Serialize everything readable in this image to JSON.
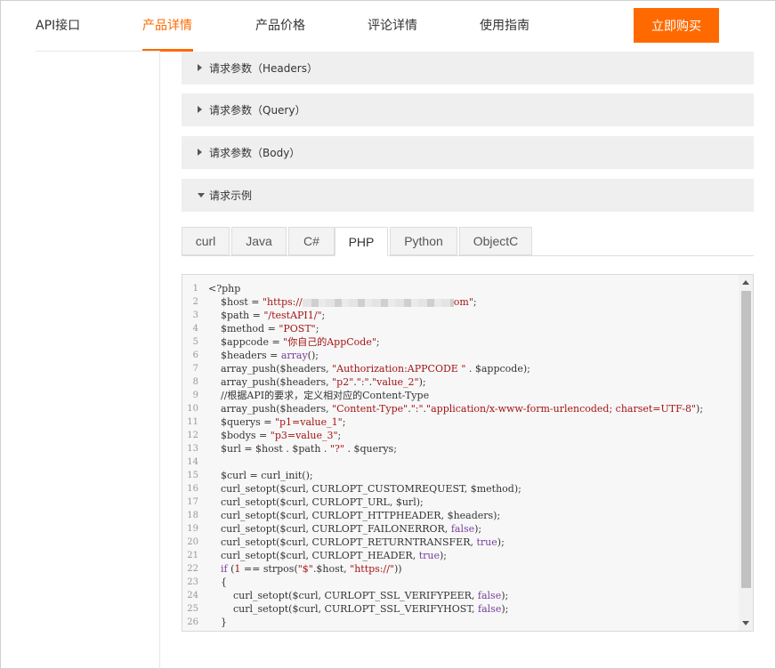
{
  "nav": {
    "items": [
      {
        "label": "API接口"
      },
      {
        "label": "产品详情"
      },
      {
        "label": "产品价格"
      },
      {
        "label": "评论详情"
      },
      {
        "label": "使用指南"
      }
    ],
    "active_index": 1,
    "buy_label": "立即购买",
    "accent_color": "#ff6a00"
  },
  "sections": [
    {
      "label": "请求参数（Headers）",
      "expanded": false
    },
    {
      "label": "请求参数（Query）",
      "expanded": false
    },
    {
      "label": "请求参数（Body）",
      "expanded": false
    },
    {
      "label": "请求示例",
      "expanded": true
    }
  ],
  "tabs": [
    {
      "label": "curl"
    },
    {
      "label": "Java"
    },
    {
      "label": "C#"
    },
    {
      "label": "PHP"
    },
    {
      "label": "Python"
    },
    {
      "label": "ObjectC"
    }
  ],
  "active_tab": "PHP",
  "code": {
    "line_numbers": [
      "1",
      "2",
      "3",
      "4",
      "5",
      "6",
      "7",
      "8",
      "9",
      "10",
      "11",
      "12",
      "13",
      "14",
      "15",
      "16",
      "17",
      "18",
      "19",
      "20",
      "21",
      "22",
      "23",
      "24",
      "25",
      "26"
    ],
    "l1": "<?php",
    "l2a": "    $host = ",
    "l2b": "\"https://",
    "l2c": "om\"",
    "l2d": ";",
    "l3a": "    $path = ",
    "l3b": "\"/testAPI1/\"",
    "l3c": ";",
    "l4a": "    $method = ",
    "l4b": "\"POST\"",
    "l4c": ";",
    "l5a": "    $appcode = ",
    "l5b": "\"你自己的AppCode\"",
    "l5c": ";",
    "l6a": "    $headers = ",
    "l6b": "array",
    "l6c": "();",
    "l7a": "    array_push($headers, ",
    "l7b": "\"Authorization:APPCODE \"",
    "l7c": " . $appcode);",
    "l8a": "    array_push($headers, ",
    "l8b": "\"p2\"",
    "l8c": ".",
    "l8d": "\":\"",
    "l8e": ".",
    "l8f": "\"value_2\"",
    "l8g": ");",
    "l9": "    //根据API的要求，定义相对应的Content-Type",
    "l10a": "    array_push($headers, ",
    "l10b": "\"Content-Type\"",
    "l10c": ".",
    "l10d": "\":\"",
    "l10e": ".",
    "l10f": "\"application/x-www-form-urlencoded; charset=UTF-8\"",
    "l10g": ");",
    "l11a": "    $querys = ",
    "l11b": "\"p1=value_1\"",
    "l11c": ";",
    "l12a": "    $bodys = ",
    "l12b": "\"p3=value_3\"",
    "l12c": ";",
    "l13a": "    $url = $host . $path . ",
    "l13b": "\"?\"",
    "l13c": " . $querys;",
    "l14": "",
    "l15": "    $curl = curl_init();",
    "l16": "    curl_setopt($curl, CURLOPT_CUSTOMREQUEST, $method);",
    "l17": "    curl_setopt($curl, CURLOPT_URL, $url);",
    "l18": "    curl_setopt($curl, CURLOPT_HTTPHEADER, $headers);",
    "l19a": "    curl_setopt($curl, CURLOPT_FAILONERROR, ",
    "l19b": "false",
    "l19c": ");",
    "l20a": "    curl_setopt($curl, CURLOPT_RETURNTRANSFER, ",
    "l20b": "true",
    "l20c": ");",
    "l21a": "    curl_setopt($curl, CURLOPT_HEADER, ",
    "l21b": "true",
    "l21c": ");",
    "l22a": "    ",
    "l22b": "if",
    "l22c": " (",
    "l22d": "1",
    "l22e": " == strpos(",
    "l22f": "\"$\"",
    "l22g": ".$host, ",
    "l22h": "\"https://\"",
    "l22i": "))",
    "l23": "    {",
    "l24a": "        curl_setopt($curl, CURLOPT_SSL_VERIFYPEER, ",
    "l24b": "false",
    "l24c": ");",
    "l25a": "        curl_setopt($curl, CURLOPT_SSL_VERIFYHOST, ",
    "l25b": "false",
    "l25c": ");",
    "l26": "    }"
  }
}
